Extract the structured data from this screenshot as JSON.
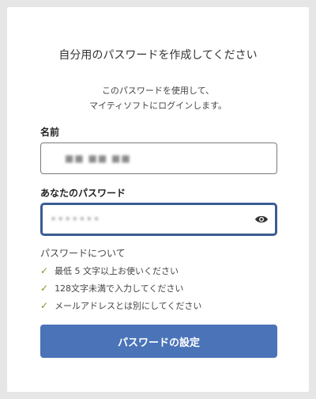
{
  "header": {
    "title": "自分用のパスワードを作成してください",
    "subtitle_line1": "このパスワードを使用して、",
    "subtitle_line2": "マイティソフトにログインします。"
  },
  "form": {
    "name_label": "名前",
    "name_value_obscured": "■■ ■■ ■■",
    "password_label": "あなたのパスワード",
    "password_value_obscured": "•••••••"
  },
  "rules": {
    "heading": "パスワードについて",
    "items": [
      "最低 5 文字以上お使いください",
      "128文字未満で入力してください",
      "メールアドレスとは別にしてください"
    ],
    "check_color": "#7a9a2a"
  },
  "submit": {
    "label": "パスワードの設定",
    "color": "#4a73b8"
  },
  "icons": {
    "reveal": "eye-icon",
    "rule_status": "check-icon"
  }
}
